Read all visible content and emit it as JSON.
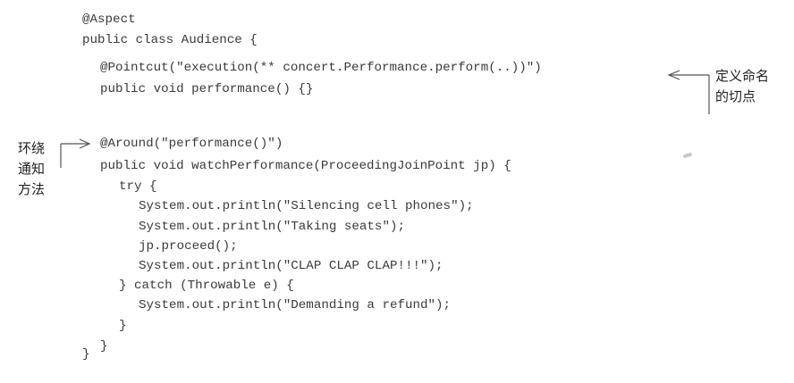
{
  "code": {
    "lines": [
      "@Aspect",
      "public class Audience {",
      "@Pointcut(\"execution(** concert.Performance.perform(..))\")",
      "public void performance() {}",
      "@Around(\"performance()\")",
      "public void watchPerformance(ProceedingJoinPoint jp) {",
      "try {",
      "System.out.println(\"Silencing cell phones\");",
      "System.out.println(\"Taking seats\");",
      "jp.proceed();",
      "System.out.println(\"CLAP CLAP CLAP!!!\");",
      "} catch (Throwable e) {",
      "System.out.println(\"Demanding a refund\");",
      "}",
      "}",
      "}"
    ]
  },
  "annotations": {
    "pointcut_note": [
      "定义命名",
      "的切点"
    ],
    "around_note": [
      "环绕",
      "通知",
      "方法"
    ]
  },
  "colors": {
    "code_text": "#3a3a3a",
    "annotation_line": "#555555"
  }
}
